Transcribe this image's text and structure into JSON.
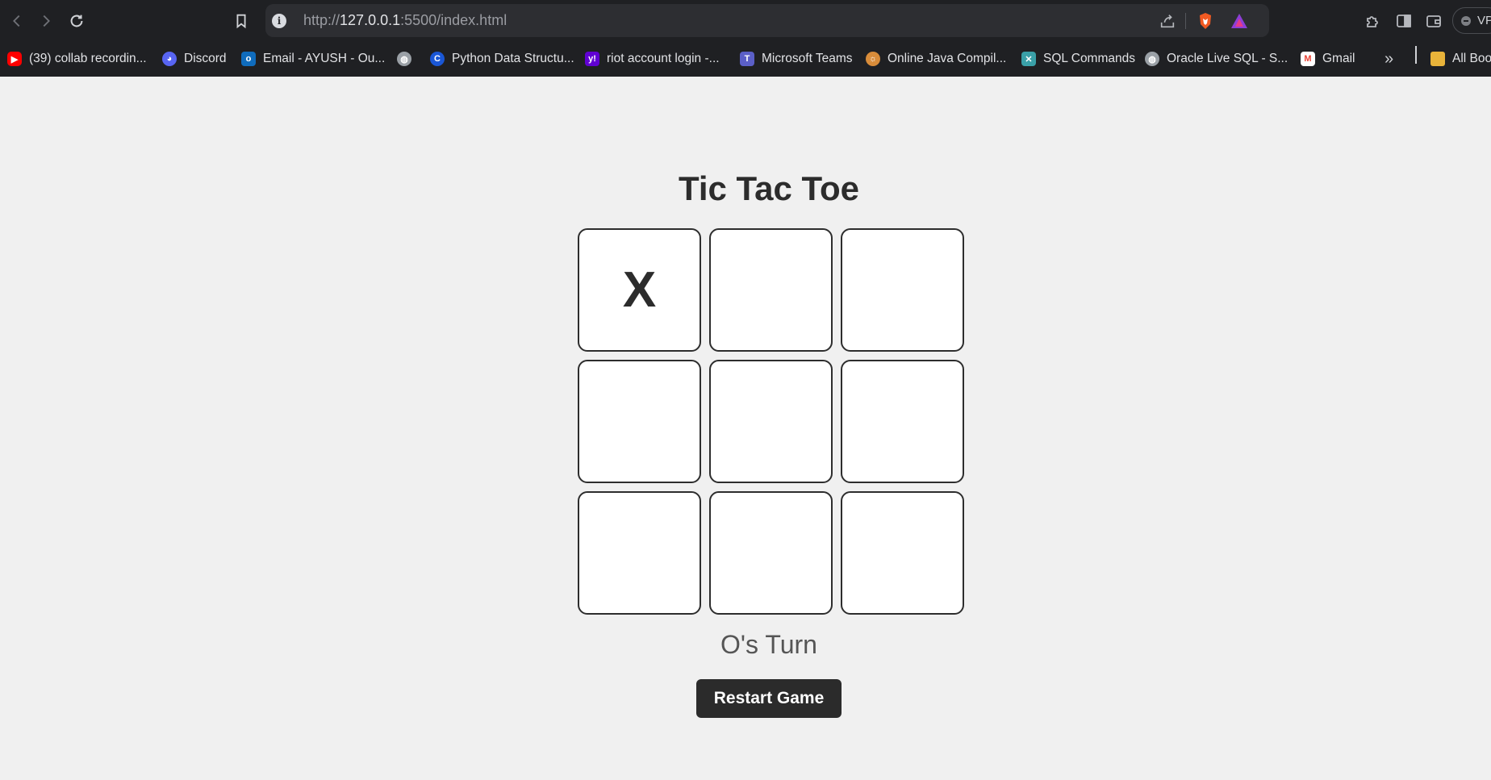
{
  "browser": {
    "url_prefix": "http://",
    "url_host": "127.0.0.1",
    "url_rest": ":5500/index.html",
    "vpn_label": "VPN",
    "bookmarks": [
      {
        "label": "(39) collab recordin...",
        "icon": "youtube-icon",
        "color": "#ff0000"
      },
      {
        "label": "Discord",
        "icon": "discord-icon",
        "color": "#5865f2"
      },
      {
        "label": "Email - AYUSH - Ou...",
        "icon": "outlook-icon",
        "color": "#0f6cbd"
      },
      {
        "label": "",
        "icon": "globe-icon",
        "color": "#9aa0a6"
      },
      {
        "label": "Python Data Structu...",
        "icon": "c-logo-icon",
        "color": "#1a57d6"
      },
      {
        "label": "riot account login -...",
        "icon": "yahoo-icon",
        "color": "#6001d2"
      },
      {
        "label": "Microsoft Teams",
        "icon": "teams-icon",
        "color": "#5b5fc7"
      },
      {
        "label": "Online Java Compil...",
        "icon": "java-compiler-icon",
        "color": "#d88c3a"
      },
      {
        "label": "SQL Commands",
        "icon": "sql-icon",
        "color": "#3aa0a8"
      },
      {
        "label": "Oracle Live SQL - S...",
        "icon": "globe-icon",
        "color": "#9aa0a6"
      },
      {
        "label": "Gmail",
        "icon": "gmail-icon",
        "color": "#ea4335"
      }
    ],
    "more_label": "»",
    "all_bookmarks_label": "All Boo"
  },
  "game": {
    "title": "Tic Tac Toe",
    "cells": [
      "X",
      "",
      "",
      "",
      "",
      "",
      "",
      "",
      ""
    ],
    "status": "O's Turn",
    "restart_label": "Restart Game"
  }
}
